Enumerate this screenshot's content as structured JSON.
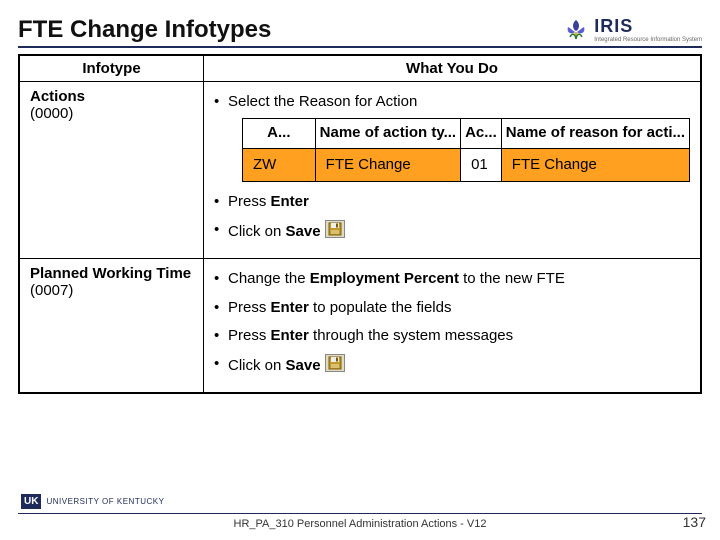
{
  "title": "FTE Change Infotypes",
  "logo": {
    "main": "IRIS",
    "sub": "Integrated Resource Information System"
  },
  "table": {
    "headers": [
      "Infotype",
      "What You Do"
    ],
    "rows": [
      {
        "name": "Actions",
        "code": "(0000)",
        "items": [
          {
            "pre": "Select the Reason for Action",
            "bold": "",
            "post": "",
            "sap": true
          },
          {
            "pre": "Press ",
            "bold": "Enter",
            "post": ""
          },
          {
            "pre": "Click on ",
            "bold": "Save",
            "post": "",
            "saveIcon": true
          }
        ]
      },
      {
        "name": "Planned Working Time",
        "code": "(0007)",
        "items": [
          {
            "pre": "Change the ",
            "bold": "Employment Percent",
            "post": " to the new FTE"
          },
          {
            "pre": "Press ",
            "bold": "Enter",
            "post": " to populate the fields"
          },
          {
            "pre": "Press ",
            "bold": "Enter",
            "post": " through the system messages"
          },
          {
            "pre": "Click on ",
            "bold": "Save",
            "post": "",
            "saveIcon": true
          }
        ]
      }
    ]
  },
  "sapGrid": {
    "headers": [
      "A...",
      "Name of action ty...",
      "Ac...",
      "Name of reason for acti..."
    ],
    "row": [
      "ZW",
      "FTE Change",
      "01",
      "FTE Change"
    ]
  },
  "footer": {
    "uk_badge": "UK",
    "uk_text": "UNIVERSITY OF KENTUCKY",
    "center": "HR_PA_310 Personnel Administration Actions - V12",
    "page": "137"
  }
}
